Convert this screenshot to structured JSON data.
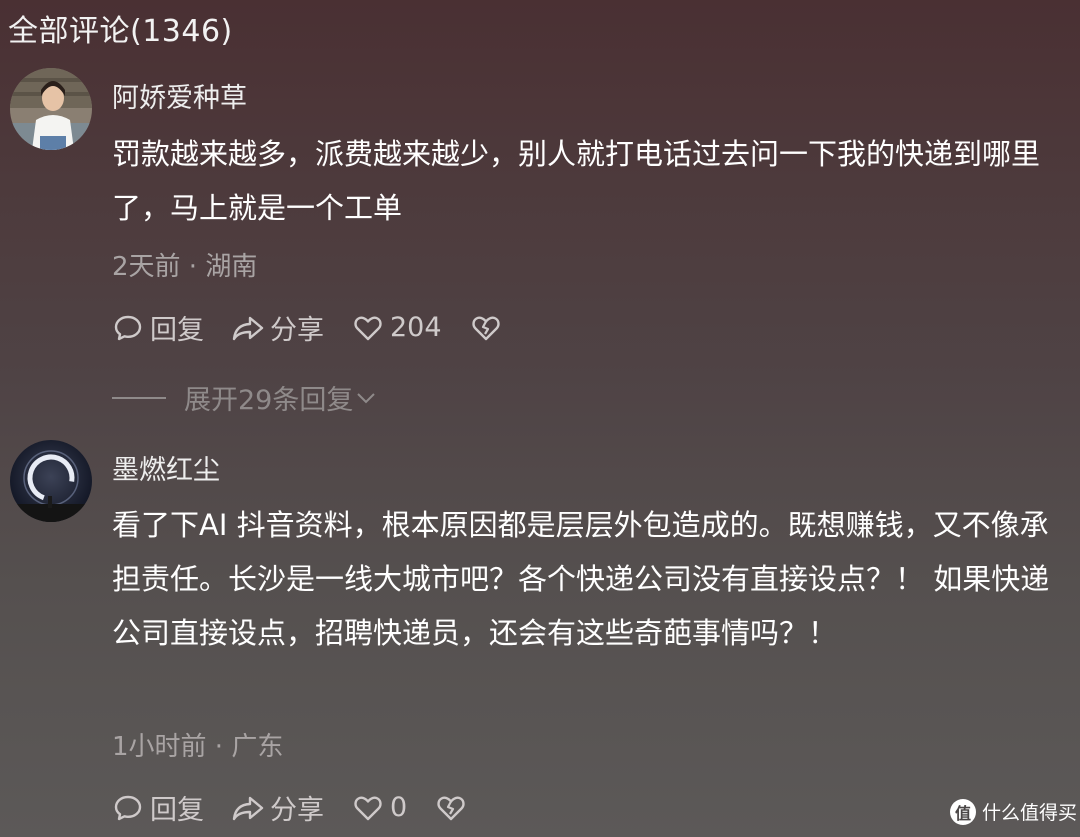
{
  "header": {
    "title": "全部评论(1346)"
  },
  "comments": [
    {
      "username": "阿娇爱种草",
      "text": "罚款越来越多，派费越来越少，别人就打电话过去问一下我的快递到哪里了，马上就是一个工单",
      "meta": "2天前 · 湖南",
      "reply_label": "回复",
      "share_label": "分享",
      "like_count": "204",
      "expand_label": "展开29条回复"
    },
    {
      "username": "墨燃红尘",
      "text": "看了下AI 抖音资料，根本原因都是层层外包造成的。既想赚钱，又不像承担责任。长沙是一线大城市吧？各个快递公司没有直接设点？！ 如果快递公司直接设点，招聘快递员，还会有这些奇葩事情吗？！",
      "meta": "1小时前 · 广东",
      "reply_label": "回复",
      "share_label": "分享",
      "like_count": "0"
    }
  ],
  "watermark": {
    "logo": "值",
    "text": "什么值得买"
  },
  "icons": [
    "comment-icon",
    "share-icon",
    "heart-icon",
    "broken-heart-icon",
    "chevron-down-icon"
  ]
}
